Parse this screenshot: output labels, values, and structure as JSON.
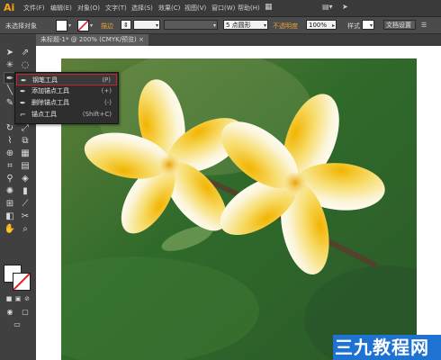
{
  "app": {
    "logo": "Ai"
  },
  "menu": {
    "items": [
      "文件(F)",
      "编辑(E)",
      "对象(O)",
      "文字(T)",
      "选择(S)",
      "效果(C)",
      "视图(V)",
      "窗口(W)",
      "帮助(H)"
    ],
    "right_icons": [
      "grid-icon",
      "send-icon"
    ]
  },
  "control": {
    "status": "未选择对象",
    "stroke_label": "描边",
    "brush_value": "5 点圆形",
    "opacity_label": "不透明度",
    "opacity_value": "100%",
    "style_label": "样式",
    "doc_setup": "文档设置",
    "accent": "#e8a23c"
  },
  "tab": {
    "title": "未标题-1* @ 200% (CMYK/预览)",
    "close": "×"
  },
  "flyout": {
    "items": [
      {
        "label": "钢笔工具",
        "shortcut": "(P)",
        "icon": "pen-icon",
        "selected": true
      },
      {
        "label": "添加锚点工具",
        "shortcut": "(+)",
        "icon": "add-anchor-icon",
        "selected": false
      },
      {
        "label": "删除锚点工具",
        "shortcut": "(-)",
        "icon": "delete-anchor-icon",
        "selected": false
      },
      {
        "label": "锚点工具",
        "shortcut": "(Shift+C)",
        "icon": "anchor-point-icon",
        "selected": false
      }
    ]
  },
  "watermark": {
    "text": "三九教程网",
    "color": "#1d72d2"
  },
  "colors": {
    "highlight": "#c0262b",
    "logo": "#f7a31b"
  }
}
